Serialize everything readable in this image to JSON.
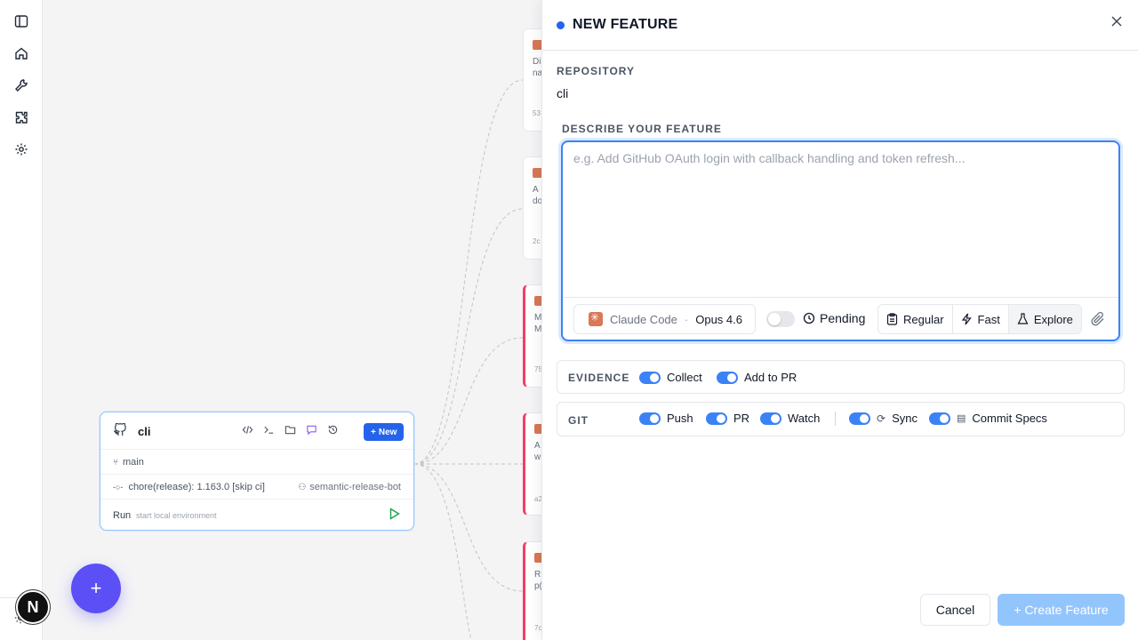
{
  "sidebar": {
    "icons": [
      "sidebar-toggle-icon",
      "home-icon",
      "wrench-icon",
      "puzzle-icon",
      "gear-icon"
    ],
    "avatar_letter": "N"
  },
  "canvas": {
    "feature_cards": [
      {
        "line1": "Di",
        "line2": "na",
        "meta": "53"
      },
      {
        "line1": "A",
        "line2": "do",
        "meta": "2c"
      },
      {
        "line1": "M",
        "line2": "M",
        "meta": "75"
      },
      {
        "line1": "A",
        "line2": "w",
        "meta": "a2"
      },
      {
        "line1": "R",
        "line2": "p(",
        "meta": "7c"
      }
    ],
    "repo_card": {
      "name": "cli",
      "new_label": "New",
      "branch": "main",
      "commit": "chore(release): 1.163.0 [skip ci]",
      "author": "semantic-release-bot",
      "run_label": "Run",
      "run_sub": "start local environment"
    },
    "fab_label": "+"
  },
  "panel": {
    "title": "NEW FEATURE",
    "repository_label": "REPOSITORY",
    "repository_value": "cli",
    "describe_label": "DESCRIBE YOUR FEATURE",
    "describe_placeholder": "e.g. Add GitHub OAuth login with callback handling and token refresh...",
    "describe_value": "",
    "agent": {
      "name": "Claude Code",
      "sep": "·",
      "model": "Opus 4.6"
    },
    "pending_label": "Pending",
    "pending_on": false,
    "modes": [
      "Regular",
      "Fast",
      "Explore"
    ],
    "active_mode": "Explore",
    "evidence": {
      "label": "EVIDENCE",
      "options": [
        {
          "label": "Collect",
          "on": true
        },
        {
          "label": "Add to PR",
          "on": true
        }
      ]
    },
    "git": {
      "label": "GIT",
      "options": [
        {
          "label": "Push",
          "on": true
        },
        {
          "label": "PR",
          "on": true
        },
        {
          "label": "Watch",
          "on": true
        },
        {
          "label": "Sync",
          "on": true
        },
        {
          "label": "Commit Specs",
          "on": true
        }
      ]
    },
    "cancel_label": "Cancel",
    "create_label": "+ Create Feature"
  },
  "colors": {
    "accent": "#3b82f6",
    "fab": "#5b4ff5",
    "card_alert": "#f43f5e",
    "claude": "#d97757"
  }
}
